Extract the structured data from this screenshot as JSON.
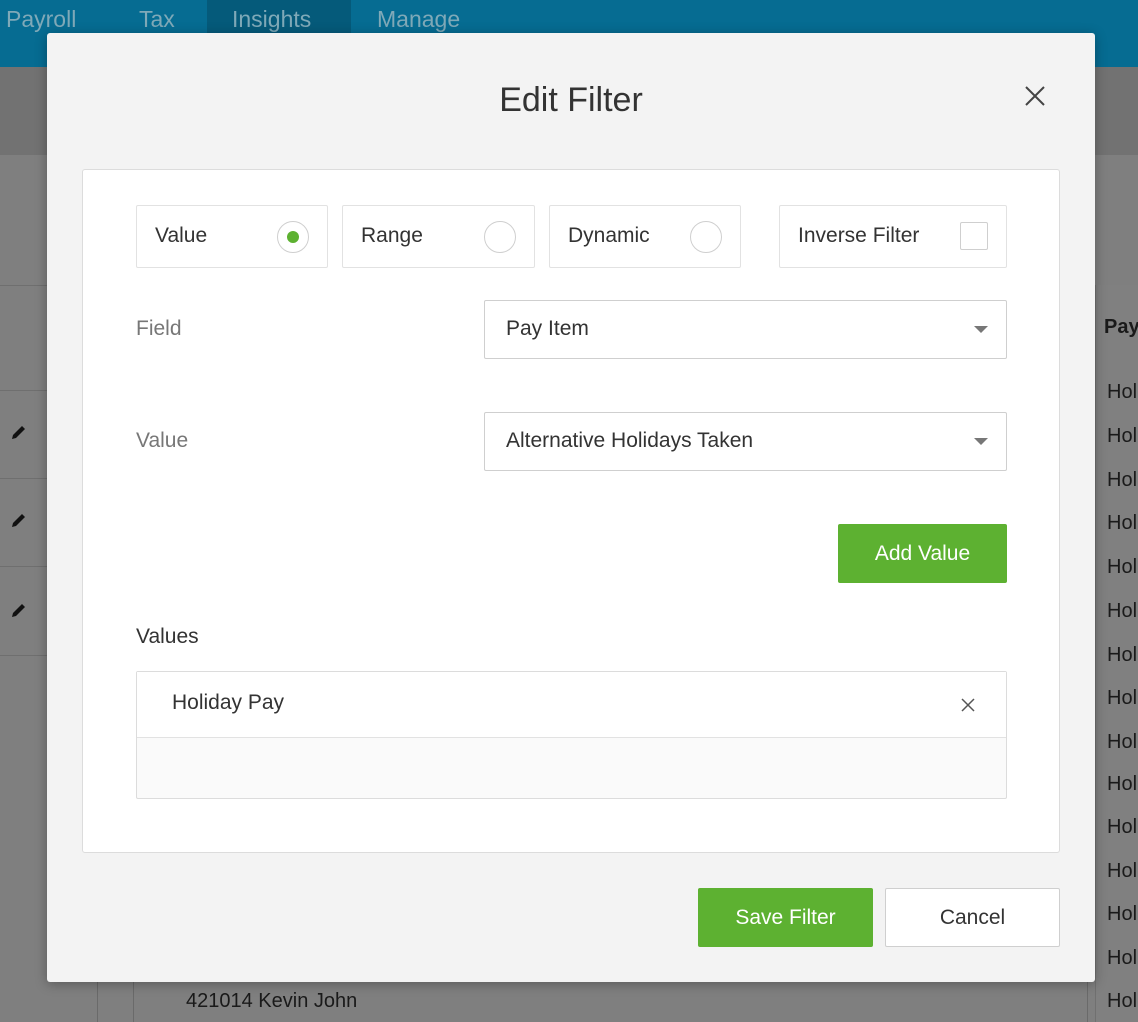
{
  "nav": {
    "tabs": [
      {
        "label": "Payroll"
      },
      {
        "label": "Tax"
      },
      {
        "label": "Insights"
      },
      {
        "label": "Manage"
      }
    ]
  },
  "background_table": {
    "right_header": "Pay",
    "right_cells": [
      "Hol",
      "Hol",
      "Hol",
      "Hol",
      "Hol",
      "Hol",
      "Hol",
      "Hol",
      "Hol",
      "Hol",
      "Hol",
      "Hol",
      "Hol",
      "Hol",
      "Hol"
    ],
    "bottom_row_text": "421014 Kevin John"
  },
  "modal": {
    "title": "Edit Filter",
    "options": {
      "value_label": "Value",
      "range_label": "Range",
      "dynamic_label": "Dynamic",
      "inverse_label": "Inverse Filter",
      "selected": "Value",
      "inverse_checked": false
    },
    "field": {
      "label": "Field",
      "selected": "Pay Item"
    },
    "value": {
      "label": "Value",
      "selected": "Alternative Holidays Taken"
    },
    "add_value_label": "Add Value",
    "values_heading": "Values",
    "values": [
      {
        "text": "Holiday Pay"
      }
    ],
    "save_label": "Save Filter",
    "cancel_label": "Cancel"
  },
  "colors": {
    "accent_green": "#5db131",
    "nav_blue": "#066c92"
  }
}
